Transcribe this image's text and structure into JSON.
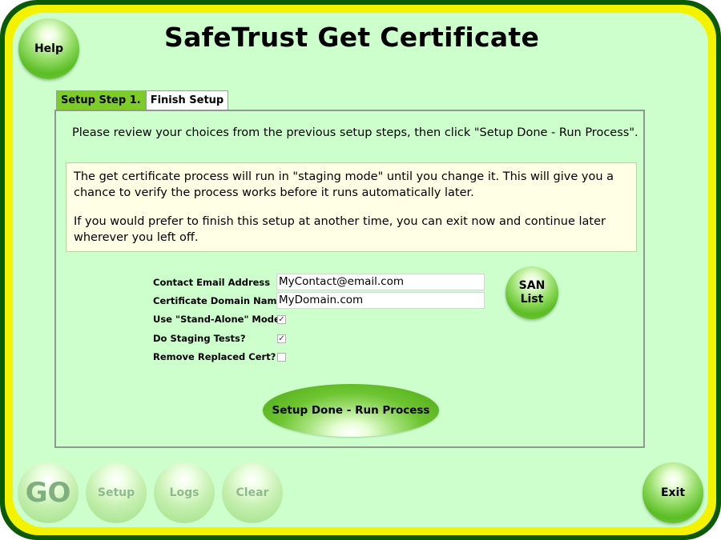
{
  "app": {
    "title": "SafeTrust Get Certificate"
  },
  "buttons": {
    "help": "Help",
    "go": "GO",
    "setup": "Setup",
    "logs": "Logs",
    "clear": "Clear",
    "exit": "Exit",
    "san_list": "SAN\nList",
    "run_process": "Setup Done - Run Process"
  },
  "tabs": [
    {
      "label": "Setup Step 1."
    },
    {
      "label": "Finish Setup"
    }
  ],
  "content": {
    "instructions": "Please review your choices from the previous setup steps, then click \"Setup Done - Run Process\".",
    "info_paragraph_1": "The get certificate process will run in \"staging mode\" until you change it. This will give you a chance to verify the process works before it runs automatically later.",
    "info_paragraph_2": "If you would prefer to finish this setup at another time, you can exit now and continue later wherever you left off."
  },
  "form": {
    "email_label": "Contact Email Address",
    "email_value": "MyContact@email.com",
    "domain_label": "Certificate Domain Name",
    "domain_value": "MyDomain.com",
    "standalone_label": "Use \"Stand-Alone\" Mode?",
    "standalone_checked": true,
    "staging_label": "Do Staging Tests?",
    "staging_checked": true,
    "remove_label": "Remove Replaced Cert?",
    "remove_checked": false
  },
  "colors": {
    "frame": "#0a5a0a",
    "frame_accent": "#f3f300",
    "panel": "#ccffcc",
    "active_tab": "#7dcc2a",
    "info_box": "#ffffe6"
  }
}
